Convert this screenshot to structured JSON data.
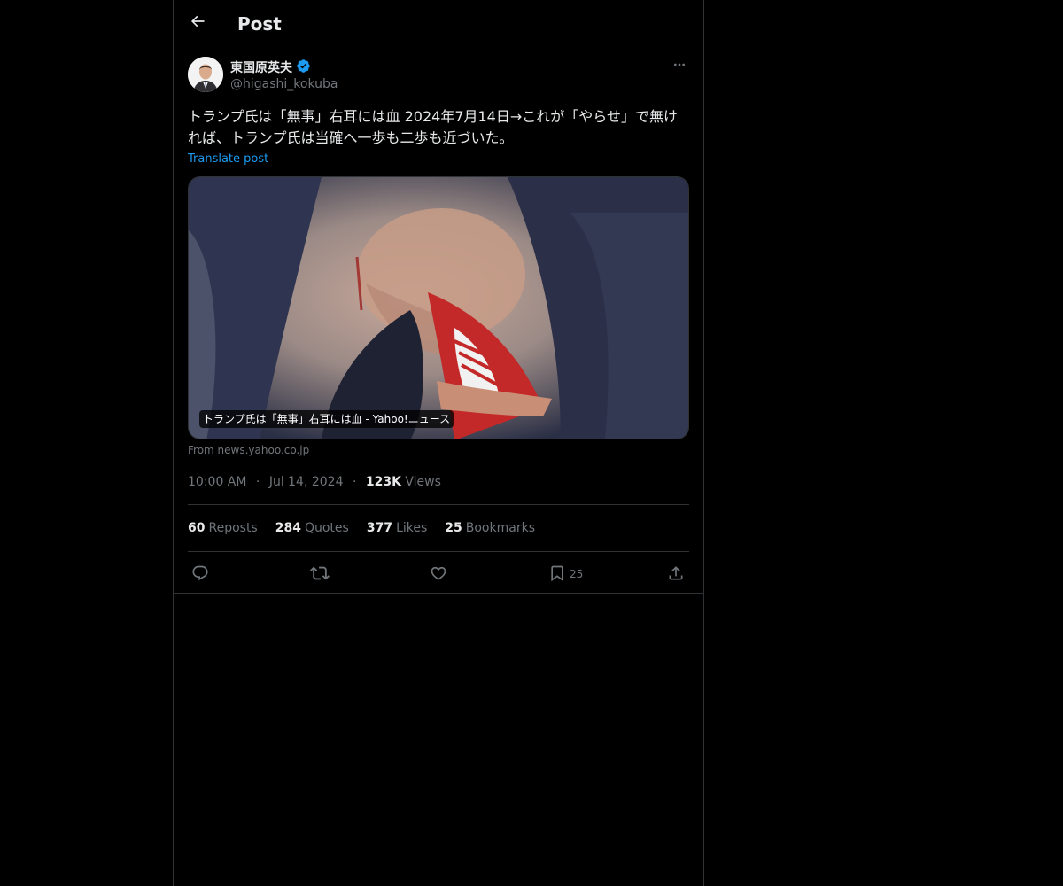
{
  "header": {
    "title": "Post",
    "back_icon": "arrow-left-icon"
  },
  "post": {
    "author_name": "東国原英夫",
    "verified_icon": "verified-badge-icon",
    "verified_color": "#1d9bf0",
    "author_handle": "@higashi_kokuba",
    "more_icon": "more-horizontal-icon",
    "text": "トランプ氏は「無事」右耳には血 2024年7月14日→これが「やらせ」で無ければ、トランプ氏は当確へ一歩も二歩も近づいた。",
    "translate_label": "Translate post",
    "link_card": {
      "caption": "トランプ氏は「無事」右耳には血 - Yahoo!ニュース",
      "source": "From news.yahoo.co.jp"
    },
    "time": "10:00 AM",
    "date": "Jul 14, 2024",
    "dot": "·",
    "views_count": "123K",
    "views_label": "Views"
  },
  "stats": {
    "reposts_count": "60",
    "reposts_label": "Reposts",
    "quotes_count": "284",
    "quotes_label": "Quotes",
    "likes_count": "377",
    "likes_label": "Likes",
    "bookmarks_count": "25",
    "bookmarks_label": "Bookmarks"
  },
  "actions": {
    "reply_icon": "reply-icon",
    "repost_icon": "repost-icon",
    "like_icon": "heart-icon",
    "bookmark_icon": "bookmark-icon",
    "bookmark_count": "25",
    "share_icon": "share-icon"
  },
  "colors": {
    "background": "#000000",
    "text_primary": "#e7e9ea",
    "text_secondary": "#71767b",
    "accent": "#1d9bf0",
    "border": "#2f3336"
  }
}
